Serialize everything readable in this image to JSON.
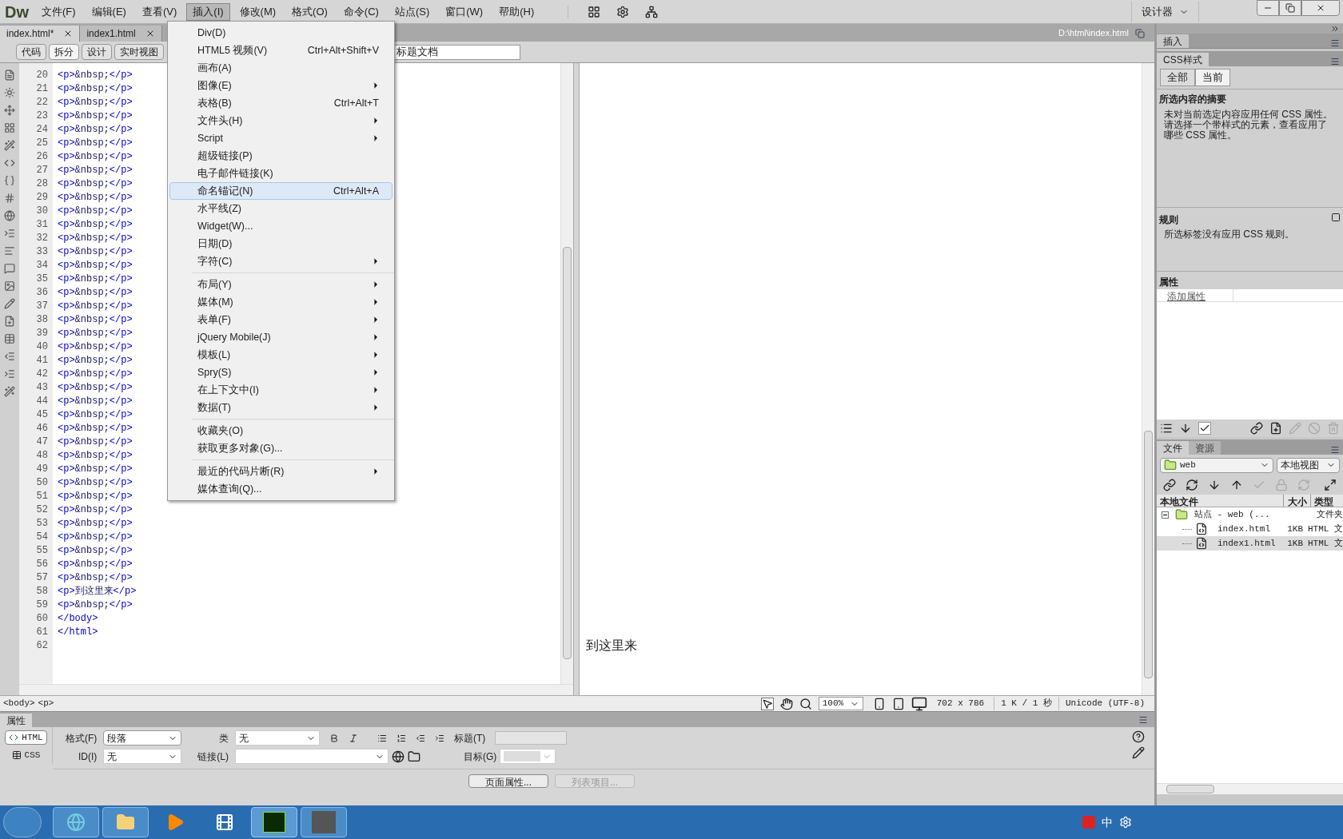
{
  "app": {
    "logo": "Dw",
    "workspace": "设计器",
    "menus": [
      {
        "label": "文件(F)",
        "selected": false
      },
      {
        "label": "编辑(E)",
        "selected": false
      },
      {
        "label": "查看(V)",
        "selected": false
      },
      {
        "label": "插入(I)",
        "selected": true
      },
      {
        "label": "修改(M)",
        "selected": false
      },
      {
        "label": "格式(O)",
        "selected": false
      },
      {
        "label": "命令(C)",
        "selected": false
      },
      {
        "label": "站点(S)",
        "selected": false
      },
      {
        "label": "窗口(W)",
        "selected": false
      },
      {
        "label": "帮助(H)",
        "selected": false
      }
    ]
  },
  "document_tabs": [
    {
      "label": "index.html*",
      "selected": true
    },
    {
      "label": "index1.html",
      "selected": false
    }
  ],
  "file_path": "D:\\html\\index.html",
  "view_buttons": [
    {
      "label": "代码",
      "selected": false
    },
    {
      "label": "拆分",
      "selected": true
    },
    {
      "label": "设计",
      "selected": false
    },
    {
      "label": "实时视图",
      "selected": false
    }
  ],
  "title_field": {
    "value": "标题文档"
  },
  "insert_menu": [
    {
      "kind": "item",
      "label": "Div(D)",
      "submenu": false,
      "selected": false
    },
    {
      "kind": "item",
      "label": "HTML5 视频(V)",
      "shortcut": "Ctrl+Alt+Shift+V",
      "submenu": false,
      "selected": false
    },
    {
      "kind": "item",
      "label": "画布(A)",
      "submenu": false,
      "selected": false
    },
    {
      "kind": "item",
      "label": "图像(E)",
      "submenu": true,
      "selected": false
    },
    {
      "kind": "item",
      "label": "表格(B)",
      "shortcut": "Ctrl+Alt+T",
      "submenu": false,
      "selected": false
    },
    {
      "kind": "item",
      "label": "文件头(H)",
      "submenu": true,
      "selected": false
    },
    {
      "kind": "item",
      "label": "Script",
      "submenu": true,
      "selected": false
    },
    {
      "kind": "item",
      "label": "超级链接(P)",
      "submenu": false,
      "selected": false
    },
    {
      "kind": "item",
      "label": "电子邮件链接(K)",
      "submenu": false,
      "selected": false
    },
    {
      "kind": "item",
      "label": "命名锚记(N)",
      "shortcut": "Ctrl+Alt+A",
      "submenu": false,
      "selected": true
    },
    {
      "kind": "item",
      "label": "水平线(Z)",
      "submenu": false,
      "selected": false
    },
    {
      "kind": "item",
      "label": "Widget(W)...",
      "submenu": false,
      "selected": false
    },
    {
      "kind": "item",
      "label": "日期(D)",
      "submenu": false,
      "selected": false
    },
    {
      "kind": "item",
      "label": "字符(C)",
      "submenu": true,
      "selected": false
    },
    {
      "kind": "separator"
    },
    {
      "kind": "item",
      "label": "布局(Y)",
      "submenu": true,
      "selected": false
    },
    {
      "kind": "item",
      "label": "媒体(M)",
      "submenu": true,
      "selected": false
    },
    {
      "kind": "item",
      "label": "表单(F)",
      "submenu": true,
      "selected": false
    },
    {
      "kind": "item",
      "label": "jQuery Mobile(J)",
      "submenu": true,
      "selected": false
    },
    {
      "kind": "item",
      "label": "模板(L)",
      "submenu": true,
      "selected": false
    },
    {
      "kind": "item",
      "label": "Spry(S)",
      "submenu": true,
      "selected": false
    },
    {
      "kind": "item",
      "label": "在上下文中(I)",
      "submenu": true,
      "selected": false
    },
    {
      "kind": "item",
      "label": "数据(T)",
      "submenu": true,
      "selected": false
    },
    {
      "kind": "separator"
    },
    {
      "kind": "item",
      "label": "收藏夹(O)",
      "submenu": false,
      "selected": false
    },
    {
      "kind": "item",
      "label": "获取更多对象(G)...",
      "submenu": false,
      "selected": false
    },
    {
      "kind": "separator"
    },
    {
      "kind": "item",
      "label": "最近的代码片断(R)",
      "submenu": true,
      "selected": false
    },
    {
      "kind": "item",
      "label": "媒体查询(Q)...",
      "submenu": false,
      "selected": false
    }
  ],
  "code_lines": [
    {
      "number": "20",
      "text": "<p>&nbsp;</p>"
    },
    {
      "number": "21",
      "text": "<p>&nbsp;</p>"
    },
    {
      "number": "22",
      "text": "<p>&nbsp;</p>"
    },
    {
      "number": "23",
      "text": "<p>&nbsp;</p>"
    },
    {
      "number": "24",
      "text": "<p>&nbsp;</p>"
    },
    {
      "number": "25",
      "text": "<p>&nbsp;</p>"
    },
    {
      "number": "26",
      "text": "<p>&nbsp;</p>"
    },
    {
      "number": "27",
      "text": "<p>&nbsp;</p>"
    },
    {
      "number": "28",
      "text": "<p>&nbsp;</p>"
    },
    {
      "number": "29",
      "text": "<p>&nbsp;</p>"
    },
    {
      "number": "30",
      "text": "<p>&nbsp;</p>"
    },
    {
      "number": "31",
      "text": "<p>&nbsp;</p>"
    },
    {
      "number": "32",
      "text": "<p>&nbsp;</p>"
    },
    {
      "number": "33",
      "text": "<p>&nbsp;</p>"
    },
    {
      "number": "34",
      "text": "<p>&nbsp;</p>"
    },
    {
      "number": "35",
      "text": "<p>&nbsp;</p>"
    },
    {
      "number": "36",
      "text": "<p>&nbsp;</p>"
    },
    {
      "number": "37",
      "text": "<p>&nbsp;</p>"
    },
    {
      "number": "38",
      "text": "<p>&nbsp;</p>"
    },
    {
      "number": "39",
      "text": "<p>&nbsp;</p>"
    },
    {
      "number": "40",
      "text": "<p>&nbsp;</p>"
    },
    {
      "number": "41",
      "text": "<p>&nbsp;</p>"
    },
    {
      "number": "42",
      "text": "<p>&nbsp;</p>"
    },
    {
      "number": "43",
      "text": "<p>&nbsp;</p>"
    },
    {
      "number": "44",
      "text": "<p>&nbsp;</p>"
    },
    {
      "number": "45",
      "text": "<p>&nbsp;</p>"
    },
    {
      "number": "46",
      "text": "<p>&nbsp;</p>"
    },
    {
      "number": "47",
      "text": "<p>&nbsp;</p>"
    },
    {
      "number": "48",
      "text": "<p>&nbsp;</p>"
    },
    {
      "number": "49",
      "text": "<p>&nbsp;</p>"
    },
    {
      "number": "50",
      "text": "<p>&nbsp;</p>"
    },
    {
      "number": "51",
      "text": "<p>&nbsp;</p>"
    },
    {
      "number": "52",
      "text": "<p>&nbsp;</p>"
    },
    {
      "number": "53",
      "text": "<p>&nbsp;</p>"
    },
    {
      "number": "54",
      "text": "<p>&nbsp;</p>"
    },
    {
      "number": "55",
      "text": "<p>&nbsp;</p>"
    },
    {
      "number": "56",
      "text": "<p>&nbsp;</p>"
    },
    {
      "number": "57",
      "text": "<p>&nbsp;</p>"
    },
    {
      "number": "58",
      "text": "<p>到这里来</p>"
    },
    {
      "number": "59",
      "text": "<p>&nbsp;</p>"
    },
    {
      "number": "60",
      "text": "</body>"
    },
    {
      "number": "61",
      "text": "</html>"
    },
    {
      "number": "62"
    }
  ],
  "design_view": {
    "text": "到这里来"
  },
  "status_bar": {
    "tags": [
      "<body>",
      "<p>"
    ],
    "zoom": "100%",
    "size": "702 x 786",
    "download": "1 K / 1 秒",
    "encoding": "Unicode (UTF-8)"
  },
  "properties": {
    "tab": "属性",
    "modes": [
      {
        "label": "HTML",
        "selected": true
      },
      {
        "label": "CSS",
        "selected": false
      }
    ],
    "format": {
      "label": "格式(F)",
      "value": "段落"
    },
    "id": {
      "label": "ID(I)",
      "value": "无"
    },
    "class": {
      "label": "类",
      "value": "无"
    },
    "link": {
      "label": "链接(L)"
    },
    "title": {
      "label": "标题(T)"
    },
    "target": {
      "label": "目标(G)"
    },
    "buttons": [
      {
        "label": "页面属性...",
        "disabled": false
      },
      {
        "label": "列表项目...",
        "disabled": true
      }
    ]
  },
  "right_panel": {
    "insert_tab": "插入",
    "css_tab": "CSS样式",
    "css_modes": [
      {
        "label": "全部",
        "selected": false
      },
      {
        "label": "当前",
        "selected": true
      }
    ],
    "summary_title": "所选内容的摘要",
    "summary_text": "未对当前选定内容应用任何 CSS 属性。请选择一个带样式的元素，查看应用了哪些 CSS 属性。",
    "rules_title": "规则",
    "rules_text": "所选标签没有应用 CSS 规则。",
    "props_title": "属性",
    "add_property": "添加属性",
    "files": {
      "tabs": [
        {
          "label": "文件",
          "selected": true
        },
        {
          "label": "资源",
          "selected": false
        }
      ],
      "site": "web",
      "view": "本地视图",
      "columns": [
        "本地文件",
        "大小",
        "类型"
      ],
      "tree": [
        {
          "name": "站点 - web (...",
          "type": "文件夹",
          "expanded": true,
          "selected": false,
          "children": [
            {
              "name": "index.html",
              "size": "1KB",
              "type": "HTML 文",
              "selected": false
            },
            {
              "name": "index1.html",
              "size": "1KB",
              "type": "HTML 文",
              "selected": true
            }
          ]
        }
      ]
    }
  },
  "taskbar": {
    "tray": [
      "中"
    ]
  }
}
